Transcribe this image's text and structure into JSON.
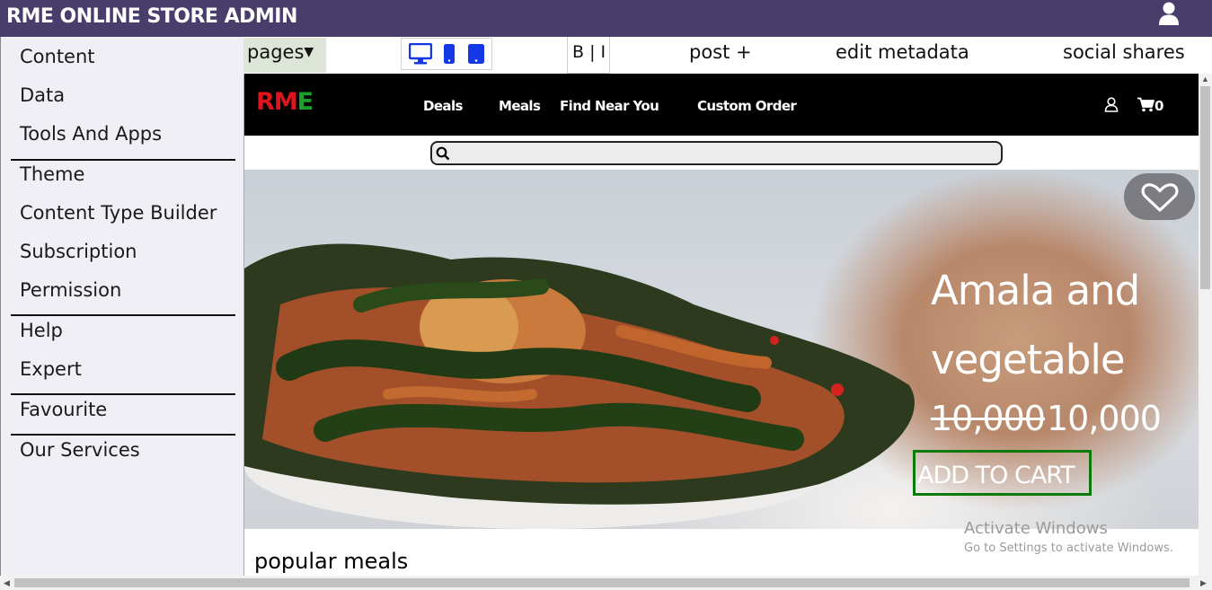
{
  "admin": {
    "title": "RME ONLINE STORE ADMIN",
    "user_icon": "user-icon"
  },
  "sidebar": {
    "items": [
      {
        "label": "Content"
      },
      {
        "label": "Data"
      },
      {
        "label": "Tools And Apps"
      },
      {
        "label": "Theme"
      },
      {
        "label": "Content Type Builder"
      },
      {
        "label": "Subscription"
      },
      {
        "label": "Permission"
      },
      {
        "label": "Help"
      },
      {
        "label": "Expert"
      },
      {
        "label": "Favourite"
      },
      {
        "label": "Our Services"
      }
    ]
  },
  "toolbar": {
    "pages_label": "pages",
    "format_label": "B | I",
    "post_label": "post +",
    "metadata_label": "edit metadata",
    "social_label": "social shares",
    "device_icons": [
      "desktop-icon",
      "mobile-icon",
      "tablet-icon"
    ]
  },
  "site": {
    "logo_r": "RM",
    "logo_e": "E",
    "nav": [
      "Deals",
      "Meals",
      "Find Near You",
      "Custom Order"
    ],
    "cart_count": "0",
    "search_placeholder": ""
  },
  "hero": {
    "title": "Amala and vegetable",
    "price_old": "10,000",
    "price_new": "10,000",
    "cta": "ADD TO CART"
  },
  "section_title": "popular meals",
  "watermark": {
    "title": "Activate Windows",
    "subtitle": "Go to Settings to activate Windows."
  },
  "colors": {
    "admin_bar": "#483d6b",
    "logo_red": "#e0141e",
    "logo_green": "#1aa12b",
    "cta_border": "#0b7a0b",
    "device_icon_blue": "#1438e6"
  }
}
